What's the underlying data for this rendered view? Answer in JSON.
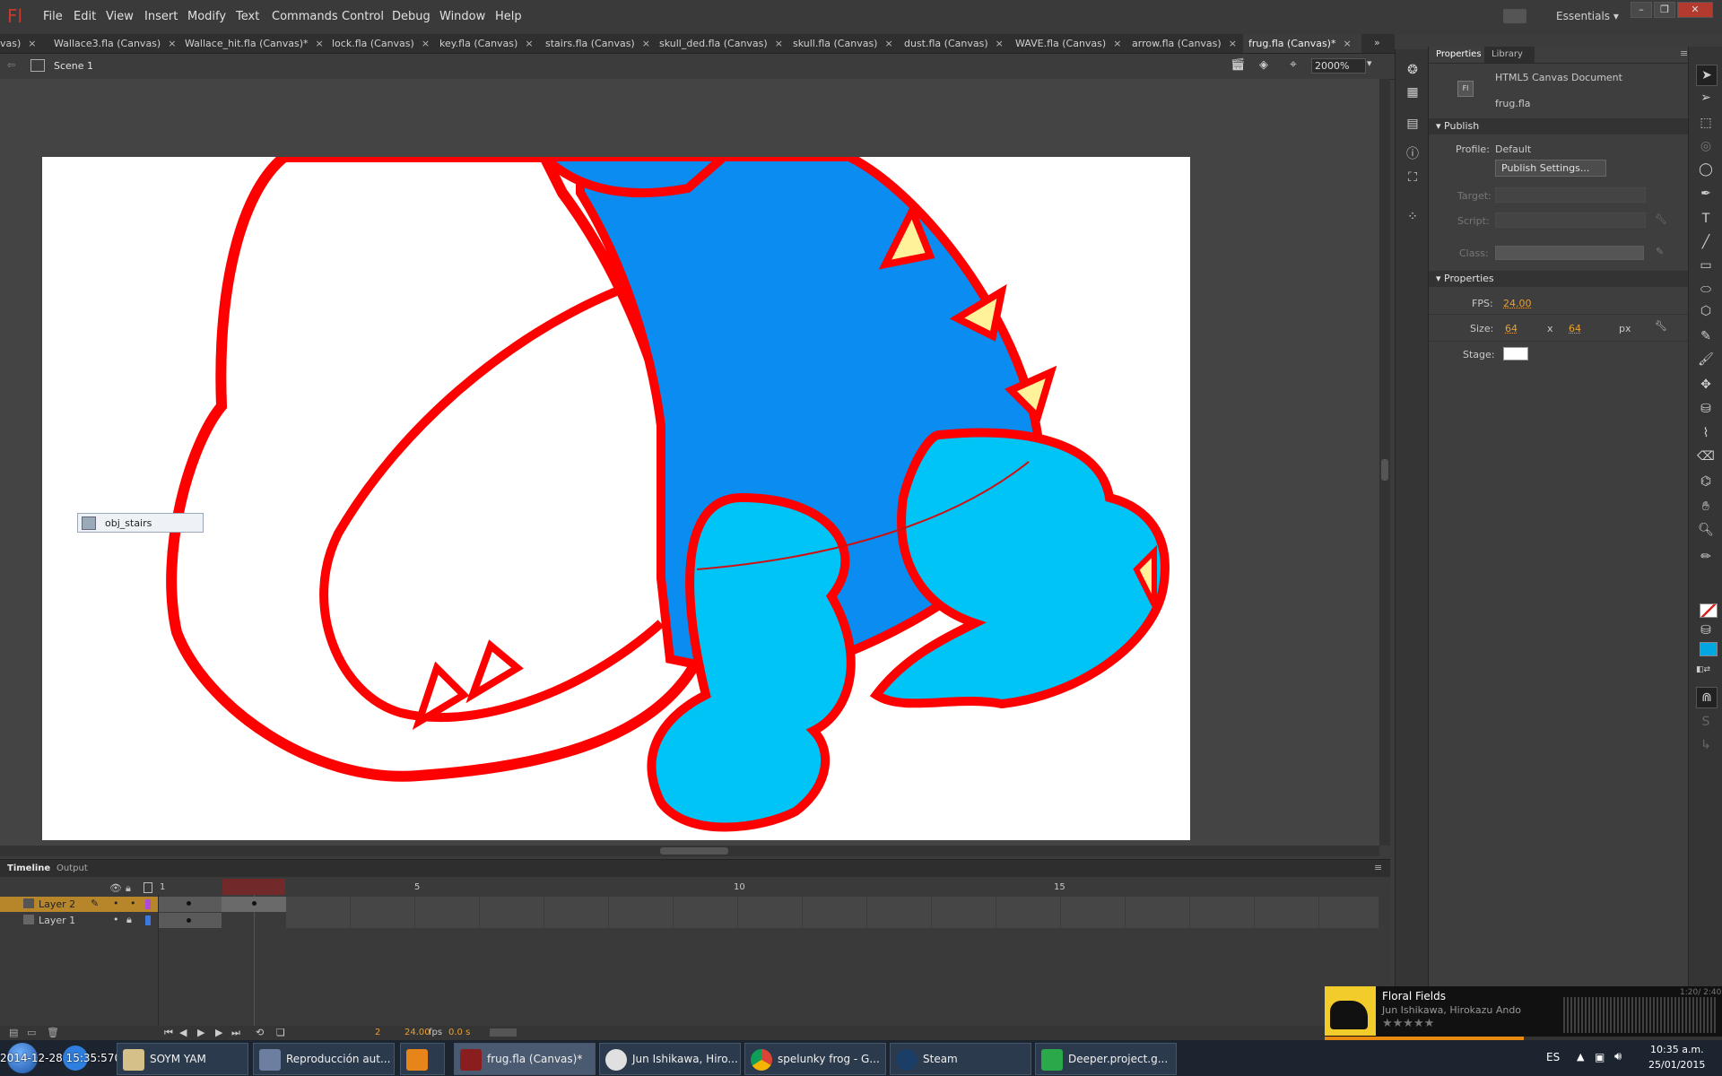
{
  "app": {
    "logo": "Fl"
  },
  "menu": [
    "File",
    "Edit",
    "View",
    "Insert",
    "Modify",
    "Text",
    "Commands",
    "Control",
    "Debug",
    "Window",
    "Help"
  ],
  "workspace": "Essentials",
  "tabs": [
    {
      "label": "vas)"
    },
    {
      "label": "Wallace3.fla (Canvas)"
    },
    {
      "label": "Wallace_hit.fla (Canvas)*"
    },
    {
      "label": "lock.fla (Canvas)"
    },
    {
      "label": "key.fla (Canvas)"
    },
    {
      "label": "stairs.fla (Canvas)"
    },
    {
      "label": "skull_ded.fla (Canvas)"
    },
    {
      "label": "skull.fla (Canvas)"
    },
    {
      "label": "dust.fla (Canvas)"
    },
    {
      "label": "WAVE.fla (Canvas)"
    },
    {
      "label": "arrow.fla (Canvas)"
    },
    {
      "label": "frug.fla (Canvas)*"
    }
  ],
  "editbar": {
    "scene": "Scene 1",
    "zoom": "2000%"
  },
  "stage": {
    "tooltip": "obj_stairs"
  },
  "timeline": {
    "tabs": [
      "Timeline",
      "Output"
    ],
    "frame_numbers": [
      "1",
      "5",
      "10",
      "15"
    ],
    "layers": [
      {
        "name": "Layer 2"
      },
      {
        "name": "Layer 1"
      }
    ],
    "current_frame": "2",
    "fps": "24.00",
    "fps_unit": "fps",
    "time": "0.0 s"
  },
  "properties": {
    "tabs": [
      "Properties",
      "Library"
    ],
    "doc_type": "HTML5 Canvas Document",
    "doc_name": "frug.fla",
    "publish_header": "Publish",
    "profile_label": "Profile:",
    "profile_value": "Default",
    "publish_settings": "Publish Settings...",
    "target_label": "Target:",
    "script_label": "Script:",
    "class_label": "Class:",
    "props_header": "Properties",
    "fps_label": "FPS:",
    "fps_value": "24.00",
    "size_label": "Size:",
    "width": "64",
    "x": "x",
    "height": "64",
    "unit": "px",
    "stage_label": "Stage:",
    "stage_color": "#ffffff"
  },
  "music": {
    "title": "Floral Fields",
    "artist": "Jun Ishikawa, Hirokazu Ando",
    "time": "1:20/ 2:40"
  },
  "taskbar": {
    "overlay_text": "2014-12-28 15:35:570 5.",
    "items": [
      {
        "label": "SOYM YAM"
      },
      {
        "label": "Reproducción aut..."
      },
      {
        "label": ""
      },
      {
        "label": "frug.fla (Canvas)*"
      },
      {
        "label": "Jun Ishikawa, Hiro..."
      },
      {
        "label": "spelunky frog - G..."
      },
      {
        "label": "Steam"
      },
      {
        "label": "Deeper.project.g..."
      }
    ],
    "lang": "ES",
    "clock_time": "10:35 a.m.",
    "clock_date": "25/01/2015"
  },
  "colors": {
    "outline": "#ff0000",
    "body": "#0a8cf0",
    "limb": "#00c4f5",
    "spike": "#fff29a",
    "accent": "#e8a032"
  }
}
